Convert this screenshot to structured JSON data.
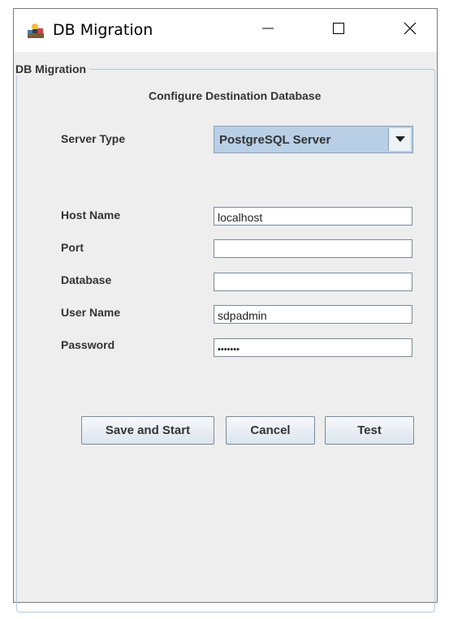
{
  "window": {
    "title": "DB Migration",
    "controls": {
      "minimize": "minimize",
      "maximize": "maximize",
      "close": "close"
    }
  },
  "panel": {
    "legend": "DB Migration",
    "heading": "Configure Destination Database"
  },
  "form": {
    "server_type_label": "Server Type",
    "server_type_value": "PostgreSQL Server",
    "host_label": "Host Name",
    "host_value": "localhost",
    "port_label": "Port",
    "port_value": "",
    "database_label": "Database",
    "database_value": "",
    "user_label": "User Name",
    "user_value": "sdpadmin",
    "password_label": "Password",
    "password_value": "•••••••"
  },
  "buttons": {
    "save_start": "Save and Start",
    "cancel": "Cancel",
    "test": "Test"
  },
  "icons": {
    "app": "app-icon",
    "minimize": "minimize-icon",
    "maximize": "maximize-icon",
    "close": "close-icon",
    "dropdown": "chevron-down-icon"
  },
  "colors": {
    "combo_bg": "#b8cfe5",
    "window_bg": "#eeeeee",
    "border": "#b5c8dc"
  }
}
